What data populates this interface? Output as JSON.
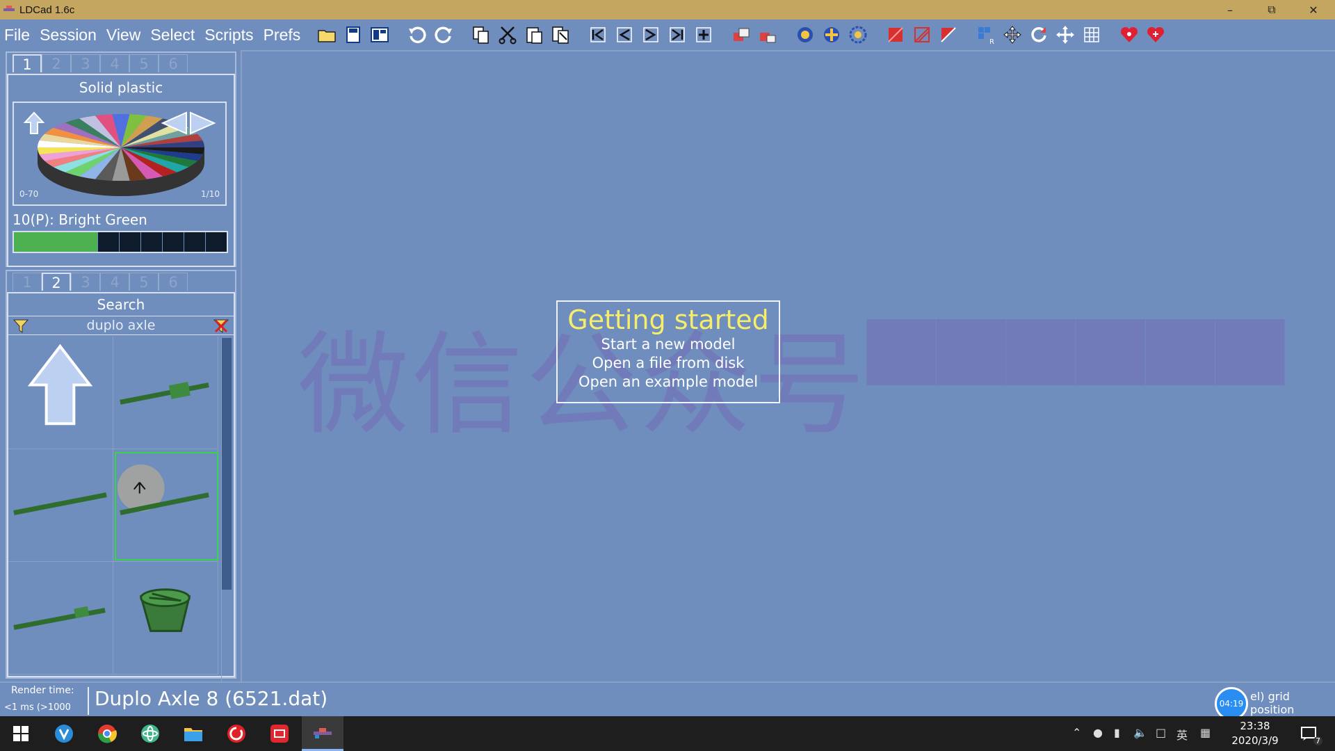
{
  "window": {
    "title": "LDCad 1.6c"
  },
  "menu": [
    "File",
    "Session",
    "View",
    "Select",
    "Scripts",
    "Prefs"
  ],
  "toolbar_icons": [
    "open-folder-icon",
    "save-icon",
    "save-all-icon",
    "undo-icon",
    "redo-icon",
    "copy-icon",
    "cut-icon",
    "paste-icon",
    "paste-special-icon",
    "first-step-icon",
    "prev-step-icon",
    "next-step-icon",
    "last-step-icon",
    "add-step-icon",
    "submodel-icon",
    "submodel-add-icon",
    "color-pick-icon",
    "color-apply-icon",
    "color-cycle-icon",
    "hide-icon",
    "hide-others-icon",
    "unhide-icon",
    "rotation-ref-icon",
    "move-icon",
    "rotate-icon",
    "pan-icon",
    "grid-icon",
    "favorite-icon",
    "favorite-add-icon"
  ],
  "color_panel": {
    "tabs": [
      "1",
      "2",
      "3",
      "4",
      "5",
      "6"
    ],
    "active_tab": "1",
    "title": "Solid plastic",
    "range_label": "0-70",
    "page_label": "1/10",
    "selected_color": "10(P): Bright Green",
    "colors": {
      "bright_green": "#4caf50",
      "slot_empty": "#0d1b2a"
    }
  },
  "parts_panel": {
    "tabs": [
      "1",
      "2",
      "3",
      "4",
      "5",
      "6"
    ],
    "active_tab": "2",
    "title": "Search",
    "query": "duplo axle",
    "items": [
      {
        "name": "up-arrow-tile"
      },
      {
        "name": "duplo-axle-with-bushing"
      },
      {
        "name": "duplo-axle-long"
      },
      {
        "name": "duplo-axle-8-selected"
      },
      {
        "name": "duplo-axle-short-bushing"
      },
      {
        "name": "duplo-wheel-holder"
      }
    ]
  },
  "getting_started": {
    "heading": "Getting started",
    "links": [
      "Start a new model",
      "Open a file from disk",
      "Open an example model"
    ]
  },
  "watermark": "微信公众号",
  "status": {
    "render_label": "Render time:",
    "render_value": "<1 ms (>1000",
    "part_info": "Duplo Axle  8 (6521.dat)",
    "badge": "04:19",
    "grid_text": "el) grid position"
  },
  "taskbar": {
    "time": "23:38",
    "date": "2020/3/9",
    "ime": "英",
    "notifications": "7"
  }
}
